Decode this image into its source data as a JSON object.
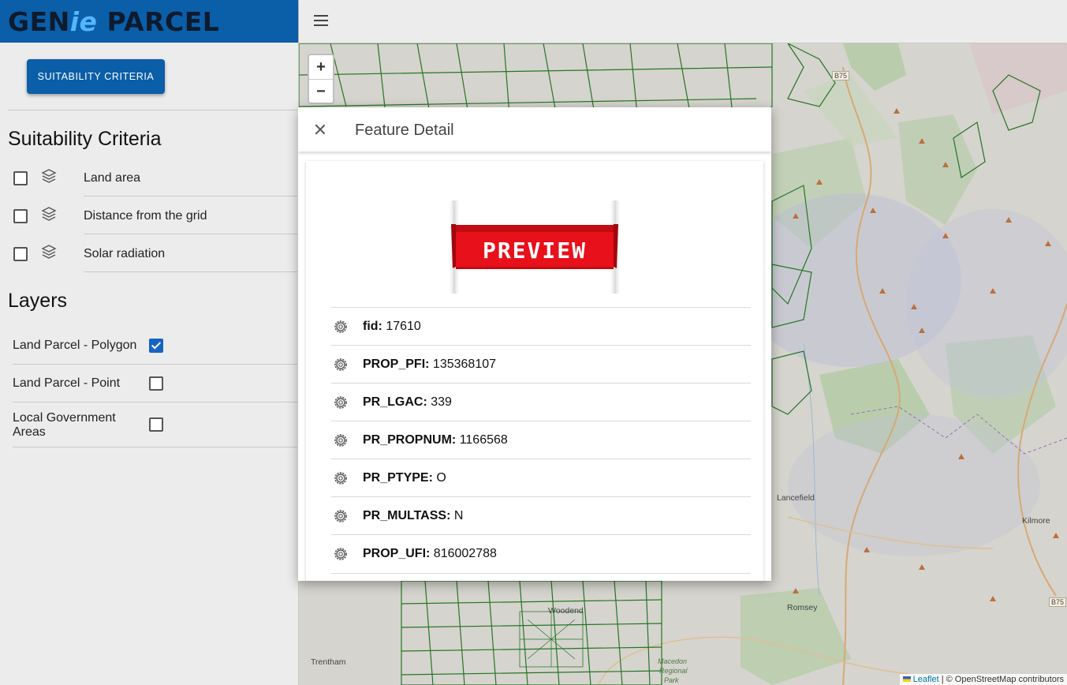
{
  "brand": {
    "part1": "GEN",
    "part2": "ie",
    "part3": " PARCEL"
  },
  "sidebar": {
    "criteria_button": "SUITABILITY CRITERIA",
    "criteria_heading": "Suitability Criteria",
    "criteria": [
      {
        "label": "Land area",
        "checked": false
      },
      {
        "label": "Distance from the grid",
        "checked": false
      },
      {
        "label": "Solar radiation",
        "checked": false
      }
    ],
    "layers_heading": "Layers",
    "layers": [
      {
        "label": "Land Parcel - Polygon",
        "checked": true
      },
      {
        "label": "Land Parcel - Point",
        "checked": false
      },
      {
        "label": "Local Government Areas",
        "checked": false
      }
    ]
  },
  "map": {
    "zoom_in": "+",
    "zoom_out": "−",
    "towns": {
      "lancefield": "Lancefield",
      "kilmore": "Kilmore",
      "romsey": "Romsey",
      "trentham": "Trentham",
      "woodend": "Woodend",
      "macedon1": "Macedon",
      "macedon2": "Regional",
      "macedon3": "Park"
    },
    "road_badges": {
      "b75_top": "B75",
      "b75_right": "B75"
    },
    "attribution": {
      "leaflet": "Leaflet",
      "rest": " | © OpenStreetMap contributors"
    }
  },
  "dialog": {
    "title": "Feature Detail",
    "preview_text": "PREVIEW",
    "attributes": [
      {
        "key": "fid:",
        "value": "17610"
      },
      {
        "key": "PROP_PFI:",
        "value": "135368107"
      },
      {
        "key": "PR_LGAC:",
        "value": "339"
      },
      {
        "key": "PR_PROPNUM:",
        "value": "1166568"
      },
      {
        "key": "PR_PTYPE:",
        "value": "O"
      },
      {
        "key": "PR_MULTASS:",
        "value": "N"
      },
      {
        "key": "PROP_UFI:",
        "value": "816002788"
      }
    ]
  },
  "colors": {
    "brand_blue": "#0b5ea8",
    "parcel_green": "#1e7a1e",
    "check_blue": "#1565c0",
    "preview_red": "#e8101a"
  }
}
